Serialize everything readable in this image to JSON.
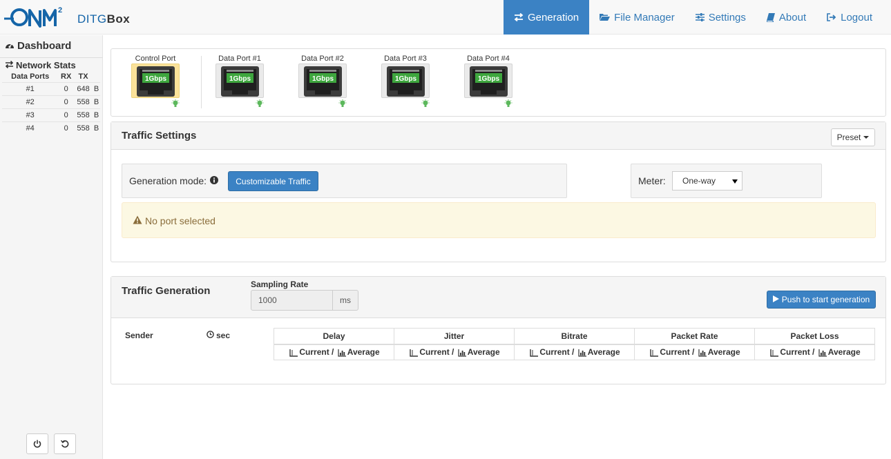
{
  "brand": {
    "logo_text": "ONM",
    "logo_super": "2",
    "name_prefix": "DITG",
    "name_suffix": "Box"
  },
  "nav": {
    "items": [
      {
        "label": "Generation",
        "icon": "exchange-icon",
        "active": true
      },
      {
        "label": "File Manager",
        "icon": "folder-open-icon",
        "active": false
      },
      {
        "label": "Settings",
        "icon": "sliders-icon",
        "active": false
      },
      {
        "label": "About",
        "icon": "book-icon",
        "active": false
      },
      {
        "label": "Logout",
        "icon": "sign-out-icon",
        "active": false
      }
    ]
  },
  "sidebar": {
    "dashboard": "Dashboard",
    "network_stats": "Network Stats",
    "table": {
      "headers": [
        "Data Ports",
        "RX",
        "TX",
        ""
      ],
      "rows": [
        [
          "#1",
          "0",
          "648",
          "B"
        ],
        [
          "#2",
          "0",
          "558",
          "B"
        ],
        [
          "#3",
          "0",
          "558",
          "B"
        ],
        [
          "#4",
          "0",
          "558",
          "B"
        ]
      ]
    }
  },
  "ports": [
    {
      "label": "Control Port",
      "speed": "1Gbps",
      "selected": true
    },
    {
      "label": "Data Port #1",
      "speed": "1Gbps",
      "selected": false
    },
    {
      "label": "Data Port #2",
      "speed": "1Gbps",
      "selected": false
    },
    {
      "label": "Data Port #3",
      "speed": "1Gbps",
      "selected": false
    },
    {
      "label": "Data Port #4",
      "speed": "1Gbps",
      "selected": false
    }
  ],
  "traffic_settings": {
    "title": "Traffic Settings",
    "preset_label": "Preset",
    "generation_mode_label": "Generation mode:",
    "generation_mode_value": "Customizable Traffic",
    "meter_label": "Meter:",
    "meter_value": "One-way",
    "warning": "No port selected"
  },
  "traffic_generation": {
    "title": "Traffic Generation",
    "sampling_rate_label": "Sampling Rate",
    "sampling_rate_value": "1000",
    "sampling_rate_unit": "ms",
    "push_label": "Push to start generation",
    "sender_header": "Sender",
    "sec_header": "sec",
    "metrics": [
      "Delay",
      "Jitter",
      "Bitrate",
      "Packet Rate",
      "Packet Loss"
    ],
    "current_label": "Current /",
    "average_label": "Average"
  },
  "colors": {
    "accent": "#3b82c4",
    "warning_bg": "#fcf8e3",
    "warning_text": "#8a6d3b",
    "led": "#5cb85c",
    "port_selected": "#fbe29a"
  }
}
